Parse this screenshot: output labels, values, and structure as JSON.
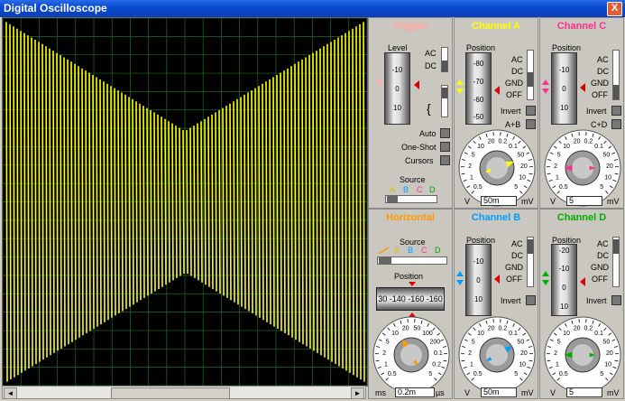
{
  "window": {
    "title": "Digital Oscilloscope",
    "close_label": "X"
  },
  "colors": {
    "trace": "#ffff00",
    "grid": "#1e6e1e",
    "ch_a": "#ffff00",
    "ch_b": "#00a0ff",
    "ch_c": "#ff2f8f",
    "ch_d": "#00b000",
    "trigger": "#ffb0b0",
    "horizontal": "#ff9900"
  },
  "trigger": {
    "title": "Trigger",
    "level_label": "Level",
    "level_ticks": [
      "-10",
      "0",
      "10"
    ],
    "ac": "AC",
    "dc": "DC",
    "auto": "Auto",
    "one_shot": "One-Shot",
    "cursors": "Cursors",
    "source_label": "Source",
    "source_options": [
      "A",
      "B",
      "C",
      "D"
    ]
  },
  "horizontal": {
    "title": "Horizontal",
    "source_label": "Source",
    "source_options": [
      "A",
      "B",
      "C",
      "D"
    ],
    "position_label": "Position",
    "position_values": "30 -140 -160 -160",
    "dial_labels": [
      "0.5",
      "1",
      "2",
      "5",
      "10",
      "20",
      "50",
      "100",
      "200",
      "0.1",
      "0.2",
      "5",
      "10",
      "20",
      "50",
      "100",
      "200"
    ],
    "unit_left": "ms",
    "unit_right": "µs",
    "value": "0.2m"
  },
  "channels": [
    {
      "id": "a",
      "title": "Channel A",
      "position_label": "Position",
      "ticks": [
        "-80",
        "-70",
        "-60",
        "-50"
      ],
      "modes": [
        "AC",
        "DC",
        "GND",
        "OFF"
      ],
      "invert": "Invert",
      "combine": "A+B",
      "unit_left": "V",
      "unit_right": "mV",
      "value": "50m",
      "dial_labels": [
        "0.5",
        "1",
        "2",
        "5",
        "10",
        "20",
        "0.2",
        "0.1",
        "50",
        "20",
        "10",
        "5",
        "2"
      ]
    },
    {
      "id": "c",
      "title": "Channel C",
      "position_label": "Position",
      "ticks": [
        "-10",
        "0",
        "10"
      ],
      "modes": [
        "AC",
        "DC",
        "GND",
        "OFF"
      ],
      "invert": "Invert",
      "combine": "C+D",
      "unit_left": "V",
      "unit_right": "mV",
      "value": "5",
      "dial_labels": [
        "0.5",
        "1",
        "2",
        "5",
        "10",
        "20",
        "0.2",
        "0.1",
        "50",
        "20",
        "10",
        "5",
        "2"
      ]
    },
    {
      "id": "b",
      "title": "Channel B",
      "position_label": "Position",
      "ticks": [
        "-10",
        "0",
        "10"
      ],
      "modes": [
        "AC",
        "DC",
        "GND",
        "OFF"
      ],
      "invert": "Invert",
      "combine": "",
      "unit_left": "V",
      "unit_right": "mV",
      "value": "50m",
      "dial_labels": [
        "0.5",
        "1",
        "2",
        "5",
        "10",
        "20",
        "0.2",
        "0.1",
        "50",
        "20",
        "10",
        "5",
        "2"
      ]
    },
    {
      "id": "d",
      "title": "Channel D",
      "position_label": "Position",
      "ticks": [
        "-20",
        "-10",
        "0",
        "10"
      ],
      "modes": [
        "AC",
        "DC",
        "GND",
        "OFF"
      ],
      "invert": "Invert",
      "combine": "",
      "unit_left": "V",
      "unit_right": "mV",
      "value": "5",
      "dial_labels": [
        "0.5",
        "1",
        "2",
        "5",
        "10",
        "20",
        "0.2",
        "0.1",
        "50",
        "20",
        "10",
        "5",
        "2"
      ]
    }
  ],
  "scroll": {
    "left": "◄",
    "right": "►"
  }
}
